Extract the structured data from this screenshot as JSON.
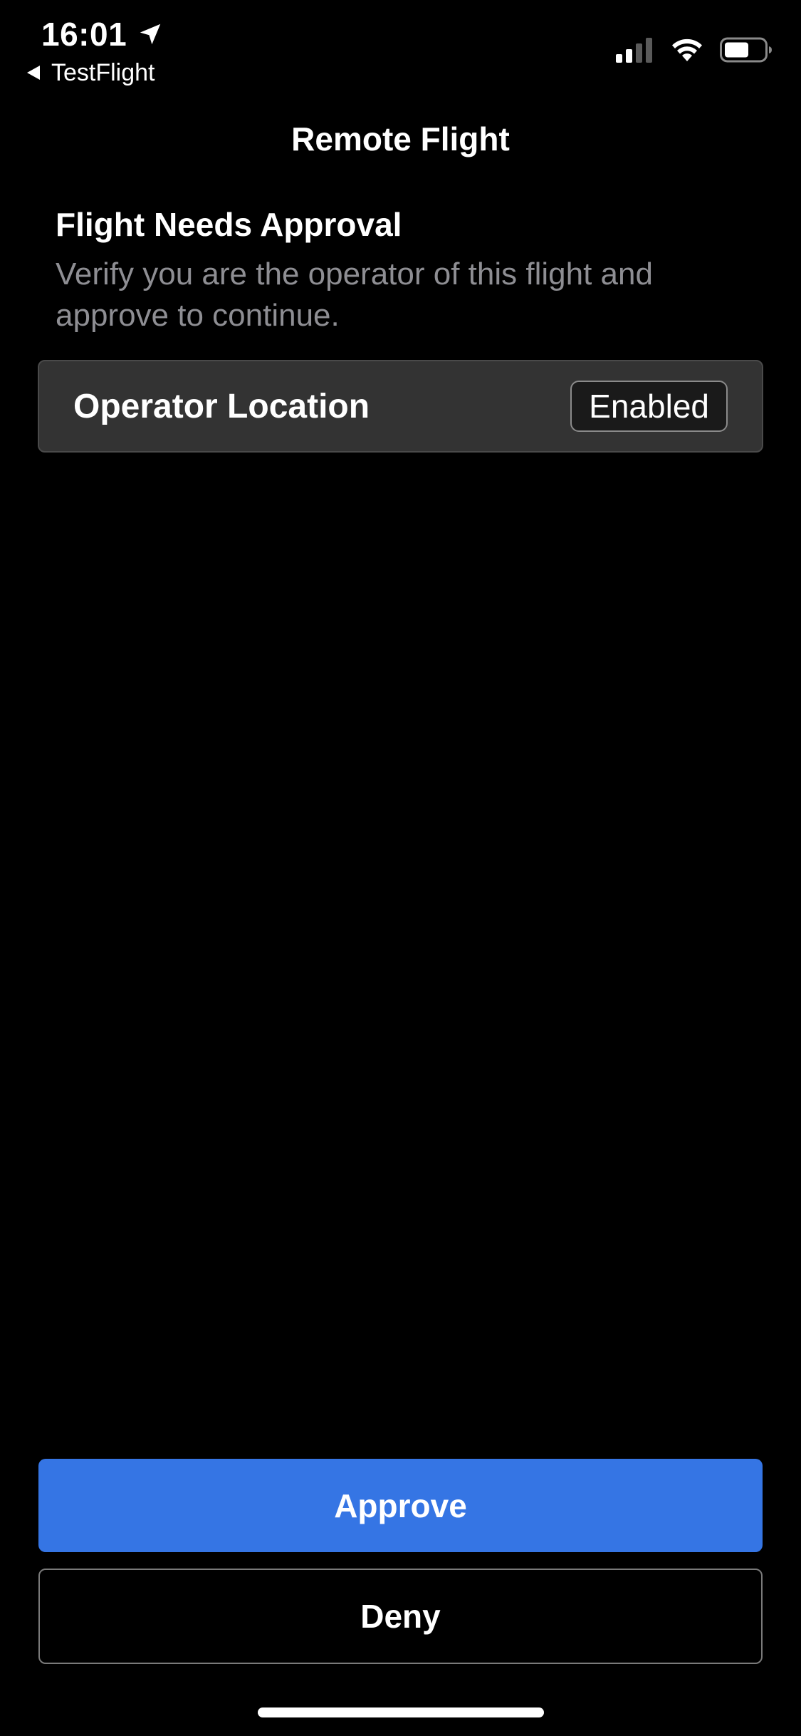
{
  "status_bar": {
    "time": "16:01",
    "location_icon": "location-arrow-icon",
    "signal_icon": "cellular-signal-icon",
    "wifi_icon": "wifi-icon",
    "battery_icon": "battery-icon"
  },
  "back_link": {
    "label": "TestFlight",
    "icon": "back-triangle-icon"
  },
  "header": {
    "title": "Remote Flight"
  },
  "approval": {
    "heading": "Flight Needs Approval",
    "description": "Verify you are the operator of this flight and approve to continue."
  },
  "operator_location": {
    "label": "Operator Location",
    "status": "Enabled"
  },
  "actions": {
    "approve_label": "Approve",
    "deny_label": "Deny"
  },
  "colors": {
    "background": "#000000",
    "card": "#333333",
    "accent": "#3575e4",
    "secondary_text": "#8e8e93"
  }
}
